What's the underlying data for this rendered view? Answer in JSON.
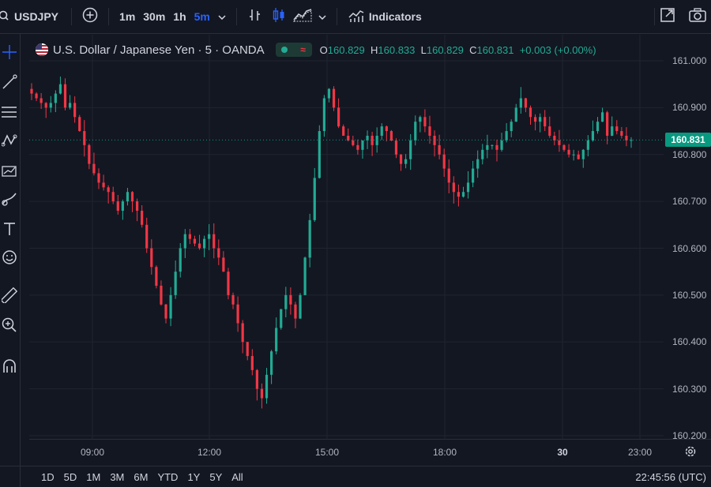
{
  "toolbar": {
    "symbol": "USDJPY",
    "intervals": [
      {
        "label": "1m",
        "active": false
      },
      {
        "label": "30m",
        "active": false
      },
      {
        "label": "1h",
        "active": false
      },
      {
        "label": "5m",
        "active": true
      }
    ],
    "indicators_label": "Indicators"
  },
  "legend": {
    "title": "U.S. Dollar / Japanese Yen · 5 · OANDA",
    "wave_glyph": "≈",
    "o_key": "O",
    "o_val": "160.829",
    "h_key": "H",
    "h_val": "160.833",
    "l_key": "L",
    "l_val": "160.829",
    "c_key": "C",
    "c_val": "160.831",
    "change": "+0.003 (+0.00%)"
  },
  "last_price": "160.831",
  "bottom": {
    "ranges": [
      "1D",
      "5D",
      "1M",
      "3M",
      "6M",
      "YTD",
      "1Y",
      "5Y",
      "All"
    ],
    "clock": "22:45:56 (UTC)"
  },
  "colors": {
    "up": "#22ab94",
    "down": "#f23645",
    "accent": "#2962ff",
    "last_line": "#089981"
  },
  "chart_data": {
    "type": "candlestick",
    "symbol": "USDJPY",
    "interval": "5",
    "ylim": [
      160.2,
      161.0
    ],
    "y_ticks": [
      "161.000",
      "160.900",
      "160.800",
      "160.700",
      "160.600",
      "160.500",
      "160.400",
      "160.300",
      "160.200"
    ],
    "x_ticks": [
      {
        "label": "09:00",
        "bold": false
      },
      {
        "label": "12:00",
        "bold": false
      },
      {
        "label": "15:00",
        "bold": false
      },
      {
        "label": "18:00",
        "bold": false
      },
      {
        "label": "30",
        "bold": true
      },
      {
        "label": "23:00",
        "bold": false
      }
    ],
    "last_value": 160.831,
    "close_path": [
      160.93,
      160.92,
      160.91,
      160.9,
      160.91,
      160.93,
      160.95,
      160.9,
      160.91,
      160.88,
      160.85,
      160.82,
      160.78,
      160.76,
      160.74,
      160.73,
      160.72,
      160.7,
      160.68,
      160.7,
      160.72,
      160.7,
      160.68,
      160.65,
      160.6,
      160.56,
      160.52,
      160.48,
      160.45,
      160.5,
      160.55,
      160.6,
      160.63,
      160.62,
      160.61,
      160.6,
      160.62,
      160.63,
      160.6,
      160.58,
      160.55,
      160.5,
      160.48,
      160.44,
      160.4,
      160.37,
      160.34,
      160.3,
      160.28,
      160.33,
      160.38,
      160.43,
      160.47,
      160.5,
      160.48,
      160.45,
      160.5,
      160.58,
      160.66,
      160.75,
      160.85,
      160.92,
      160.94,
      160.9,
      160.86,
      160.84,
      160.83,
      160.82,
      160.81,
      160.83,
      160.84,
      160.82,
      160.84,
      160.86,
      160.85,
      160.83,
      160.8,
      160.78,
      160.79,
      160.83,
      160.87,
      160.88,
      160.86,
      160.84,
      160.82,
      160.8,
      160.77,
      160.74,
      160.72,
      160.71,
      160.72,
      160.74,
      160.77,
      160.79,
      160.81,
      160.82,
      160.82,
      160.81,
      160.83,
      160.85,
      160.87,
      160.9,
      160.92,
      160.9,
      160.88,
      160.87,
      160.88,
      160.86,
      160.84,
      160.83,
      160.82,
      160.81,
      160.8,
      160.8,
      160.79,
      160.81,
      160.83,
      160.85,
      160.87,
      160.89,
      160.84,
      160.86,
      160.85,
      160.84,
      160.83,
      160.831
    ]
  }
}
